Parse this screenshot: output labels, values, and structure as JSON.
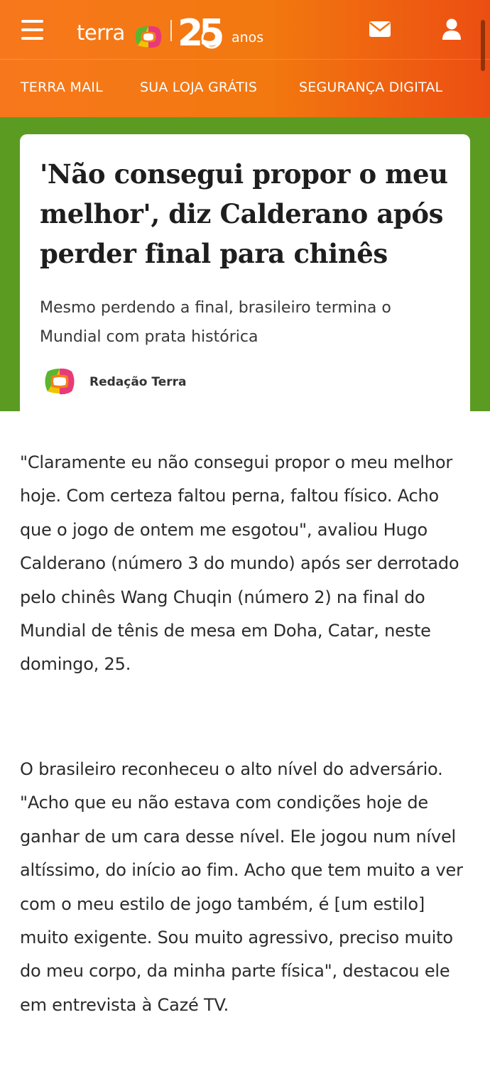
{
  "header": {
    "logo_text": "terra",
    "anniversary_number": "25",
    "anniversary_label": "anos",
    "icons": {
      "menu": "hamburger-menu-icon",
      "mail": "envelope-icon",
      "account": "user-icon"
    },
    "colors": {
      "orange": "#f7781c",
      "orange_dark": "#ec4e12",
      "green": "#5b9b22"
    }
  },
  "nav": {
    "items": [
      {
        "label": "TERRA MAIL"
      },
      {
        "label": "SUA LOJA GRÁTIS"
      },
      {
        "label": "SEGURANÇA DIGITAL"
      }
    ]
  },
  "article": {
    "headline": "'Não consegui propor o meu melhor', diz Calderano após perder final para chinês",
    "subtitle": "Mesmo perdendo a final, brasileiro termina o Mundial com prata histórica",
    "author": "Redação Terra",
    "paragraphs": [
      "\"Claramente eu não consegui propor o meu melhor hoje. Com certeza faltou perna, faltou físico. Acho que o jogo de ontem me esgotou\", avaliou Hugo Calderano (número 3 do mundo) após ser derrotado pelo chinês Wang Chuqin (número 2) na final do Mundial de tênis de mesa em Doha, Catar, neste domingo, 25.",
      "O brasileiro reconheceu o alto nível do adversário. \"Acho que eu não estava com condições hoje de ganhar de um cara desse nível. Ele jogou num nível altíssimo, do início ao fim. Acho que tem muito a ver com o meu estilo de jogo também, é [um estilo] muito exigente. Sou muito agressivo, preciso muito do meu corpo, da minha parte física\", destacou ele em entrevista à Cazé TV."
    ]
  }
}
